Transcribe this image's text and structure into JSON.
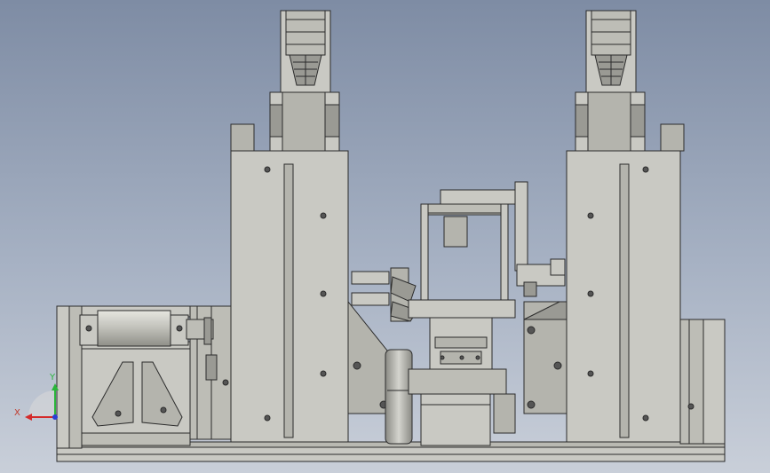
{
  "window": {
    "background_top": "#7e8ca4",
    "background_bottom": "#c9cfd9"
  },
  "model": {
    "part_color": "#c9c9c3",
    "part_shade": "#b4b4ad",
    "edge_color": "#2b2b2b"
  },
  "triad": {
    "x_label": "X",
    "y_label": "Y",
    "x_color": "#d42a2a",
    "y_color": "#2ab53a",
    "z_color": "#2a3fd4"
  }
}
